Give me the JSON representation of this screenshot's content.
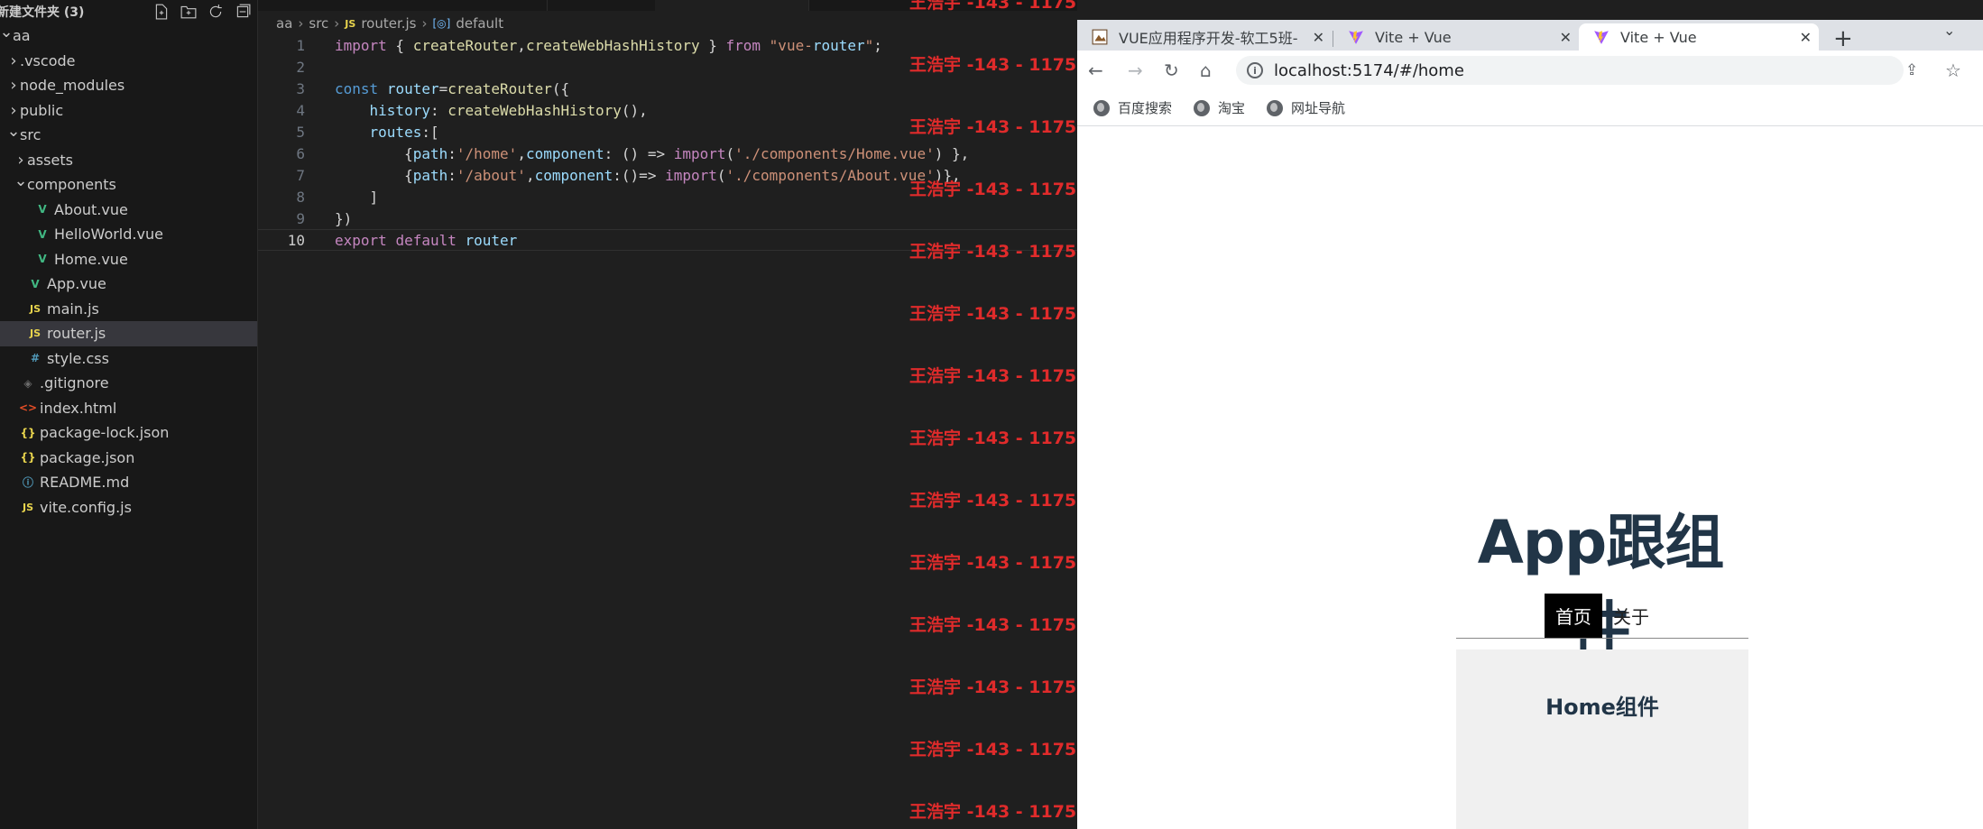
{
  "explorer": {
    "title": "新建文件夹 (3)",
    "actions": [
      "new-file-icon",
      "new-folder-icon",
      "refresh-icon",
      "collapse-all-icon"
    ],
    "items": [
      {
        "label": "aa",
        "indent": 0,
        "type": "folder-open",
        "icon": ""
      },
      {
        "label": ".vscode",
        "indent": 1,
        "type": "folder",
        "icon": ""
      },
      {
        "label": "node_modules",
        "indent": 1,
        "type": "folder",
        "icon": ""
      },
      {
        "label": "public",
        "indent": 1,
        "type": "folder",
        "icon": ""
      },
      {
        "label": "src",
        "indent": 1,
        "type": "folder-open",
        "icon": ""
      },
      {
        "label": "assets",
        "indent": 2,
        "type": "folder",
        "icon": ""
      },
      {
        "label": "components",
        "indent": 2,
        "type": "folder-open",
        "icon": ""
      },
      {
        "label": "About.vue",
        "indent": 3,
        "type": "vue",
        "icon": "V"
      },
      {
        "label": "HelloWorld.vue",
        "indent": 3,
        "type": "vue",
        "icon": "V"
      },
      {
        "label": "Home.vue",
        "indent": 3,
        "type": "vue",
        "icon": "V"
      },
      {
        "label": "App.vue",
        "indent": 2,
        "type": "vue",
        "icon": "V"
      },
      {
        "label": "main.js",
        "indent": 2,
        "type": "js",
        "icon": "JS"
      },
      {
        "label": "router.js",
        "indent": 2,
        "type": "js",
        "icon": "JS",
        "selected": true
      },
      {
        "label": "style.css",
        "indent": 2,
        "type": "css",
        "icon": "#"
      },
      {
        "label": ".gitignore",
        "indent": 1,
        "type": "git",
        "icon": "◈"
      },
      {
        "label": "index.html",
        "indent": 1,
        "type": "html",
        "icon": "<>"
      },
      {
        "label": "package-lock.json",
        "indent": 1,
        "type": "json",
        "icon": "{}"
      },
      {
        "label": "package.json",
        "indent": 1,
        "type": "json",
        "icon": "{}"
      },
      {
        "label": "README.md",
        "indent": 1,
        "type": "md",
        "icon": "ⓘ"
      },
      {
        "label": "vite.config.js",
        "indent": 1,
        "type": "js",
        "icon": "JS"
      }
    ]
  },
  "editor": {
    "breadcrumb": [
      "aa",
      "src",
      "router.js",
      "default"
    ],
    "breadcrumb_icons": {
      "file": "JS",
      "symbol": "[◎]"
    },
    "line_numbers": [
      "1",
      "2",
      "3",
      "4",
      "5",
      "6",
      "7",
      "8",
      "9",
      "10"
    ],
    "active_line": "10",
    "lines": [
      "import { createRouter,createWebHashHistory } from \"vue-router\";",
      "",
      "const router=createRouter({",
      "    history: createWebHashHistory(),",
      "    routes:[",
      "        {path:'/home',component: () => import('./components/Home.vue') },",
      "        {path:'/about',component:()=> import('./components/About.vue')},",
      "    ]",
      "})",
      "export default router"
    ],
    "watermark": "王浩宇 -143 - 1175"
  },
  "browser": {
    "tabs": [
      {
        "title": "VUE应用程序开发-软工5班-",
        "favicon": "document-icon",
        "active": false
      },
      {
        "title": "Vite + Vue",
        "favicon": "vite-icon",
        "active": false
      },
      {
        "title": "Vite + Vue",
        "favicon": "vite-icon",
        "active": true
      }
    ],
    "new_tab": "+",
    "url": "localhost:5174/#/home",
    "bookmarks": [
      "百度搜索",
      "淘宝",
      "网址导航"
    ],
    "page": {
      "heading": "App跟组件",
      "nav": [
        {
          "label": "首页",
          "active": true
        },
        {
          "label": "关于",
          "active": false
        }
      ],
      "view_heading": "Home组件"
    }
  }
}
